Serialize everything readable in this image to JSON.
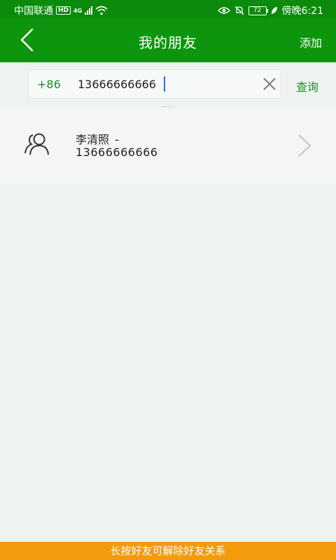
{
  "status_bar": {
    "carrier": "中国联通",
    "hd": "HD",
    "network": "4G",
    "battery": "72",
    "time": "傍晚6:21"
  },
  "header": {
    "title": "我的朋友",
    "add_label": "添加"
  },
  "search": {
    "country_code": "+86",
    "value": "13666666666",
    "query_label": "查询"
  },
  "friends": [
    {
      "name": "李清照",
      "separator": "-",
      "phone": "13666666666"
    }
  ],
  "hint": "长按好友可解除好友关系",
  "colors": {
    "header_green": "#0d960d",
    "accent_green": "#1b8f2b",
    "hint_orange": "#f39a0d"
  }
}
